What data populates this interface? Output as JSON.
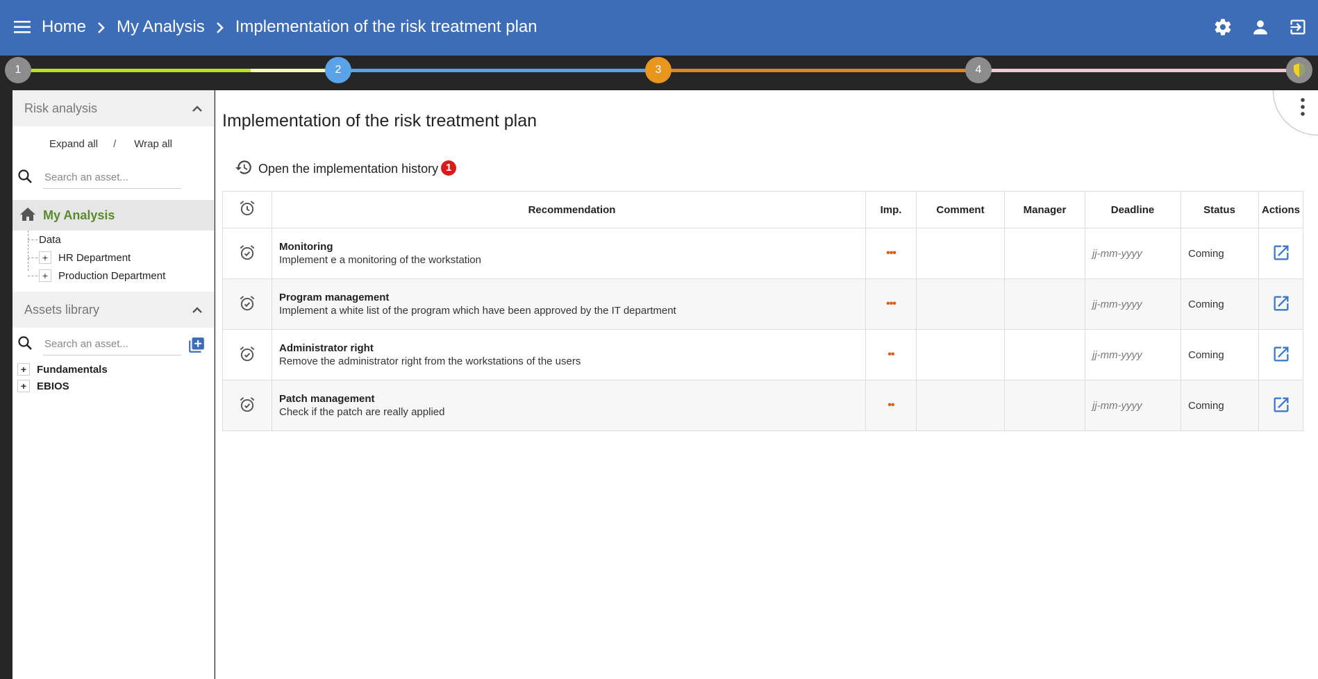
{
  "header": {
    "breadcrumb": [
      "Home",
      "My Analysis",
      "Implementation of the risk treatment plan"
    ],
    "icons": [
      "menu-icon",
      "settings-icon",
      "user-icon",
      "logout-icon"
    ]
  },
  "stepper": {
    "steps": [
      {
        "label": "1",
        "color": "#8c8c8c"
      },
      {
        "label": "2",
        "color": "#5aa3e8"
      },
      {
        "label": "3",
        "color": "#e8961e"
      },
      {
        "label": "4",
        "color": "#8c8c8c"
      }
    ],
    "segment_colors": [
      "#b8e02a",
      "#5aa3e8",
      "#e8821a",
      "#f0c8d4"
    ],
    "final_icon": "shield-icon"
  },
  "sidebar": {
    "risk_analysis_title": "Risk analysis",
    "expand_all": "Expand all",
    "separator": "/",
    "wrap_all": "Wrap all",
    "search_placeholder": "Search an asset...",
    "root_label": "My Analysis",
    "tree": [
      "Data",
      "HR Department",
      "Production Department"
    ],
    "assets_library_title": "Assets library",
    "library_search_placeholder": "Search an asset...",
    "library_items": [
      "Fundamentals",
      "EBIOS"
    ]
  },
  "main": {
    "title": "Implementation of the risk treatment plan",
    "history_link": "Open the implementation history",
    "history_badge": "1",
    "columns": [
      "Recommendation",
      "Imp.",
      "Comment",
      "Manager",
      "Deadline",
      "Status",
      "Actions"
    ],
    "rows": [
      {
        "title": "Monitoring",
        "description": "Implement e a monitoring of the workstation",
        "importance": "•••",
        "comment": "",
        "manager": "",
        "deadline": "jj-mm-yyyy",
        "status": "Coming"
      },
      {
        "title": "Program management",
        "description": "Implement a white list of the program which have been approved by the IT department",
        "importance": "•••",
        "comment": "",
        "manager": "",
        "deadline": "jj-mm-yyyy",
        "status": "Coming"
      },
      {
        "title": "Administrator right",
        "description": "Remove the administrator right from the workstations of the users",
        "importance": "••",
        "comment": "",
        "manager": "",
        "deadline": "jj-mm-yyyy",
        "status": "Coming"
      },
      {
        "title": "Patch management",
        "description": "Check if the patch are really applied",
        "importance": "••",
        "comment": "",
        "manager": "",
        "deadline": "jj-mm-yyyy",
        "status": "Coming"
      }
    ]
  }
}
